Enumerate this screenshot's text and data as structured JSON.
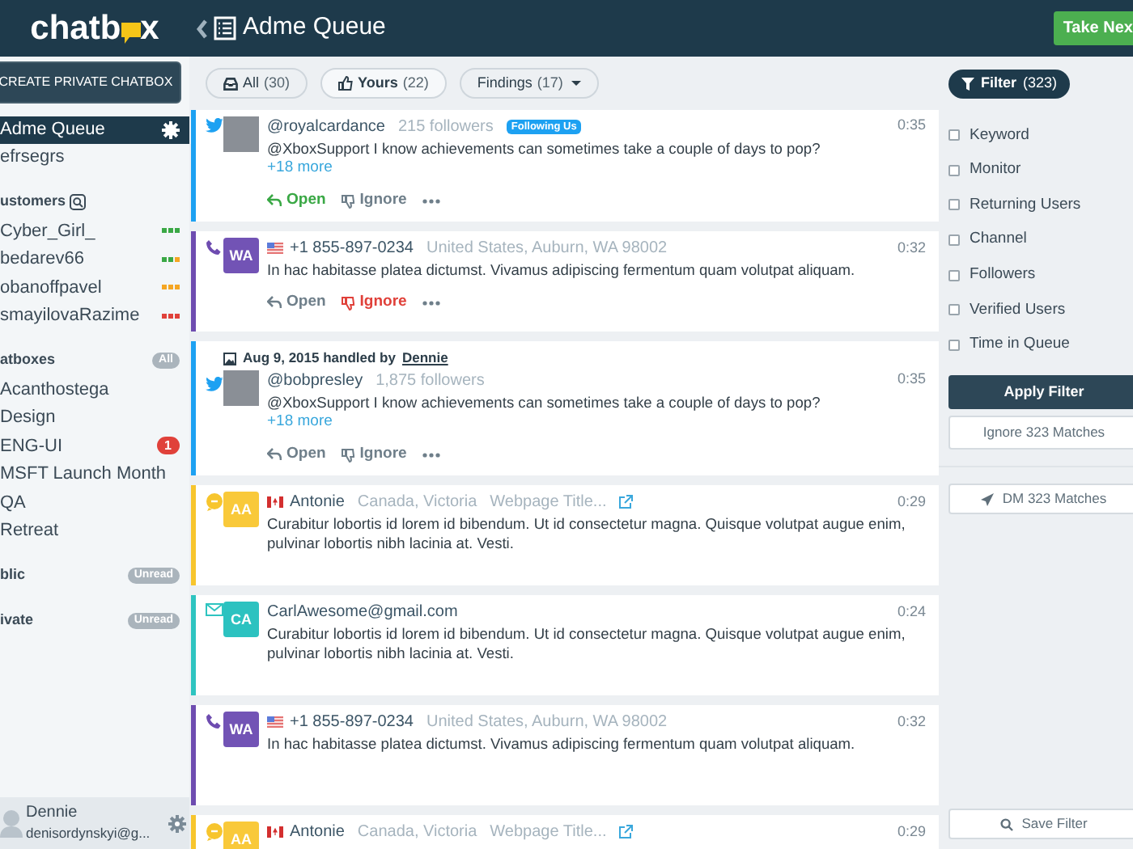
{
  "logo": {
    "before": "chatb",
    "after": "x"
  },
  "create_button": "CREATE PRIVATE CHATBOX",
  "sidebar": {
    "queues": [
      {
        "label": "Adme Queue",
        "selected": true
      },
      {
        "label": "efrsegrs",
        "selected": false
      }
    ],
    "sections": [
      {
        "title": "ustomers",
        "kind": "search",
        "items": [
          {
            "label": "Cyber_Girl_",
            "dots": [
              {
                "color": "#3aa845"
              },
              {
                "color": "#3aa845"
              },
              {
                "color": "#3aa845"
              }
            ]
          },
          {
            "label": "bedarev66",
            "dots": [
              {
                "color": "#3aa845"
              },
              {
                "color": "#3aa845"
              },
              {
                "color": "#f5a623"
              }
            ]
          },
          {
            "label": "obanoffpavel",
            "dots": [
              {
                "color": "#f5a623"
              },
              {
                "color": "#f5a623"
              },
              {
                "color": "#f5a623"
              }
            ]
          },
          {
            "label": "smayilovaRazime",
            "dots": [
              {
                "color": "#e0413a"
              },
              {
                "color": "#e0413a"
              },
              {
                "color": "#e0413a"
              }
            ]
          }
        ]
      },
      {
        "title": "atboxes",
        "kind": "pill",
        "pill": "All",
        "items": [
          {
            "label": "Acanthostega"
          },
          {
            "label": "Design"
          },
          {
            "label": "ENG-UI",
            "badge": "1"
          },
          {
            "label": "MSFT Launch Month"
          },
          {
            "label": "QA"
          },
          {
            "label": "Retreat"
          }
        ]
      },
      {
        "title": "blic",
        "kind": "pill",
        "pill": "Unread"
      },
      {
        "title": "ivate",
        "kind": "pill",
        "pill": "Unread"
      }
    ],
    "user": {
      "name": "Dennie",
      "email": "denisordynskyi@g..."
    }
  },
  "header": {
    "title": "Adme Queue",
    "action": "Take Nex"
  },
  "tabs": [
    {
      "label": "All",
      "count": "(30)",
      "kind": "inbox",
      "selected": false
    },
    {
      "label": "Yours",
      "count": "(22)",
      "kind": "thumb",
      "selected": true
    },
    {
      "label": "Findings",
      "count": "(17)",
      "kind": "dropdown",
      "selected": false
    }
  ],
  "cards": [
    {
      "kind": "twitter",
      "avatar": {
        "kind": "photo"
      },
      "name": "@royalcardance",
      "meta": [
        "215 followers"
      ],
      "tag": "Following Us",
      "time": "0:35",
      "text": "@XboxSupport I know achievements can sometimes take a couple of days to pop?",
      "more": "+18 more",
      "actions": [
        {
          "label": "Open",
          "highlighted": true
        },
        {
          "label": "Ignore",
          "highlighted": false
        }
      ]
    },
    {
      "kind": "phone",
      "avatar": {
        "kind": "initials",
        "text": "WA"
      },
      "flag": {
        "kind": "us"
      },
      "name": "+1 855-897-0234",
      "meta": [
        "United States, Auburn, WA 98002"
      ],
      "time": "0:32",
      "text": "In hac habitasse platea dictumst. Vivamus adipiscing fermentum quam volutpat aliquam.",
      "actions": [
        {
          "label": "Open",
          "highlighted": false
        },
        {
          "label": "Ignore",
          "highlighted": true
        }
      ]
    },
    {
      "kind": "twitter",
      "handled": {
        "text": "Aug 9, 2015 handled by",
        "by": "Dennie"
      },
      "avatar": {
        "kind": "photo"
      },
      "name": "@bobpresley",
      "meta": [
        "1,875 followers"
      ],
      "time": "0:35",
      "text": "@XboxSupport I know achievements can sometimes take a couple of days to pop?",
      "more": "+18 more",
      "actions": [
        {
          "label": "Open",
          "highlighted": false
        },
        {
          "label": "Ignore",
          "highlighted": false
        }
      ]
    },
    {
      "kind": "chat",
      "avatar": {
        "kind": "initials",
        "text": "AA"
      },
      "flag": {
        "kind": "ca"
      },
      "name": "Antonie",
      "meta": [
        "Canada, Victoria",
        "Webpage Title..."
      ],
      "link": true,
      "time": "0:29",
      "text": "Curabitur lobortis id lorem id bibendum. Ut id consectetur magna. Quisque volutpat augue enim, pulvinar lobortis nibh lacinia at. Vesti."
    },
    {
      "kind": "email",
      "avatar": {
        "kind": "initials",
        "text": "CA"
      },
      "name": "CarlAwesome@gmail.com",
      "time": "0:24",
      "text": "Curabitur lobortis id lorem id bibendum. Ut id consectetur magna. Quisque volutpat augue enim, pulvinar lobortis nibh lacinia at. Vesti."
    },
    {
      "kind": "phone",
      "avatar": {
        "kind": "initials",
        "text": "WA"
      },
      "flag": {
        "kind": "us"
      },
      "name": "+1 855-897-0234",
      "meta": [
        "United States, Auburn, WA 98002"
      ],
      "time": "0:32",
      "text": "In hac habitasse platea dictumst. Vivamus adipiscing fermentum quam volutpat aliquam."
    },
    {
      "kind": "chat",
      "avatar": {
        "kind": "initials",
        "text": "AA"
      },
      "flag": {
        "kind": "ca"
      },
      "name": "Antonie",
      "meta": [
        "Canada, Victoria",
        "Webpage Title..."
      ],
      "link": true,
      "time": "0:29"
    }
  ],
  "filter": {
    "button": "Filter",
    "count": "(323)",
    "options": [
      {
        "label": "Keyword",
        "checked": false
      },
      {
        "label": "Monitor",
        "checked": false
      },
      {
        "label": "Returning Users",
        "checked": false
      },
      {
        "label": "Channel",
        "checked": false
      },
      {
        "label": "Followers",
        "checked": false
      },
      {
        "label": "Verified Users",
        "checked": false
      },
      {
        "label": "Time in Queue",
        "checked": false
      }
    ],
    "apply": "Apply Filter",
    "ignore": "Ignore 323 Matches",
    "dm": "DM 323 Matches",
    "save": "Save Filter"
  }
}
